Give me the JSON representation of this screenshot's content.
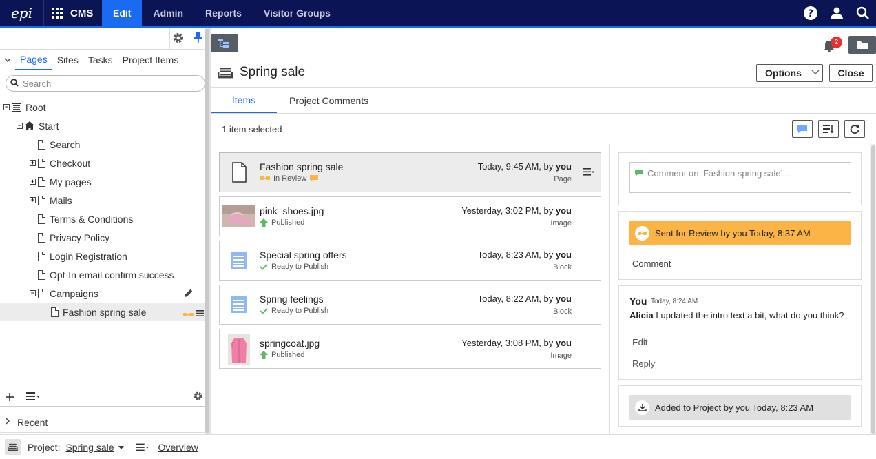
{
  "topnav": {
    "logo": "epi",
    "app": "CMS",
    "items": [
      "Edit",
      "Admin",
      "Reports",
      "Visitor Groups"
    ],
    "active": "Edit",
    "icons": [
      "help-icon",
      "user-icon",
      "search-icon"
    ]
  },
  "left": {
    "tabs": [
      "Pages",
      "Sites",
      "Tasks",
      "Project Items"
    ],
    "active_tab": "Pages",
    "search_placeholder": "Search",
    "tree": [
      {
        "label": "Root",
        "depth": 0,
        "expander": "−",
        "icon": "root-icon"
      },
      {
        "label": "Start",
        "depth": 1,
        "expander": "−",
        "icon": "home-icon"
      },
      {
        "label": "Search",
        "depth": 2,
        "expander": "",
        "icon": "page-icon"
      },
      {
        "label": "Checkout",
        "depth": 2,
        "expander": "+",
        "icon": "page-icon"
      },
      {
        "label": "My pages",
        "depth": 2,
        "expander": "+",
        "icon": "page-icon"
      },
      {
        "label": "Mails",
        "depth": 2,
        "expander": "+",
        "icon": "page-icon"
      },
      {
        "label": "Terms & Conditions",
        "depth": 2,
        "expander": "",
        "icon": "page-icon"
      },
      {
        "label": "Privacy Policy",
        "depth": 2,
        "expander": "",
        "icon": "page-icon"
      },
      {
        "label": "Login Registration",
        "depth": 2,
        "expander": "",
        "icon": "page-icon"
      },
      {
        "label": "Opt-In email confirm success",
        "depth": 2,
        "expander": "",
        "icon": "page-icon"
      },
      {
        "label": "Campaigns",
        "depth": 2,
        "expander": "−",
        "icon": "page-icon",
        "right": "pencil-icon"
      },
      {
        "label": "Fashion spring sale",
        "depth": 3,
        "expander": "",
        "icon": "page-icon",
        "right": "review-menu",
        "selected": true
      }
    ],
    "recent": "Recent"
  },
  "main": {
    "title": "Spring sale",
    "notification_count": "2",
    "options_label": "Options",
    "close_label": "Close",
    "tabs": [
      "Items",
      "Project Comments"
    ],
    "active_tab": "Items",
    "selection_text": "1 item selected",
    "items": [
      {
        "name": "Fashion spring sale",
        "status": "In Review",
        "status_icon": "in-review-icon",
        "when": "Today, 9:45 AM, by ",
        "by": "you",
        "kind": "Page",
        "thumb": "page",
        "selected": true
      },
      {
        "name": "pink_shoes.jpg",
        "status": "Published",
        "status_icon": "published-arrow-icon",
        "when": "Yesterday, 3:02 PM, by ",
        "by": "you",
        "kind": "Image",
        "thumb": "shoes"
      },
      {
        "name": "Special spring offers",
        "status": "Ready to Publish",
        "status_icon": "check-icon",
        "when": "Today, 8:23 AM, by ",
        "by": "you",
        "kind": "Block",
        "thumb": "block"
      },
      {
        "name": "Spring feelings",
        "status": "Ready to Publish",
        "status_icon": "check-icon",
        "when": "Today, 8:22 AM, by ",
        "by": "you",
        "kind": "Block",
        "thumb": "block"
      },
      {
        "name": "springcoat.jpg",
        "status": "Published",
        "status_icon": "published-arrow-icon",
        "when": "Yesterday, 3:08 PM, by ",
        "by": "you",
        "kind": "Image",
        "thumb": "coat"
      }
    ],
    "comment_placeholder": "Comment on ‘Fashion spring sale’...",
    "review_activity": "Sent for Review by you Today, 8:37 AM",
    "review_comment_link": "Comment",
    "message": {
      "author": "You",
      "time": "Today, 8:24 AM",
      "mention": "Alicia",
      "text": " I updated the intro text a bit, what do you think?",
      "edit": "Edit",
      "reply": "Reply"
    },
    "added_activity": "Added to Project by you Today, 8:23 AM"
  },
  "bottom": {
    "project_label": "Project:",
    "project_name": "Spring sale",
    "overview": "Overview"
  },
  "colors": {
    "nav_bg": "#0b1454",
    "accent": "#1a6bf2",
    "review": "#fcb446",
    "published": "#5fb760"
  }
}
